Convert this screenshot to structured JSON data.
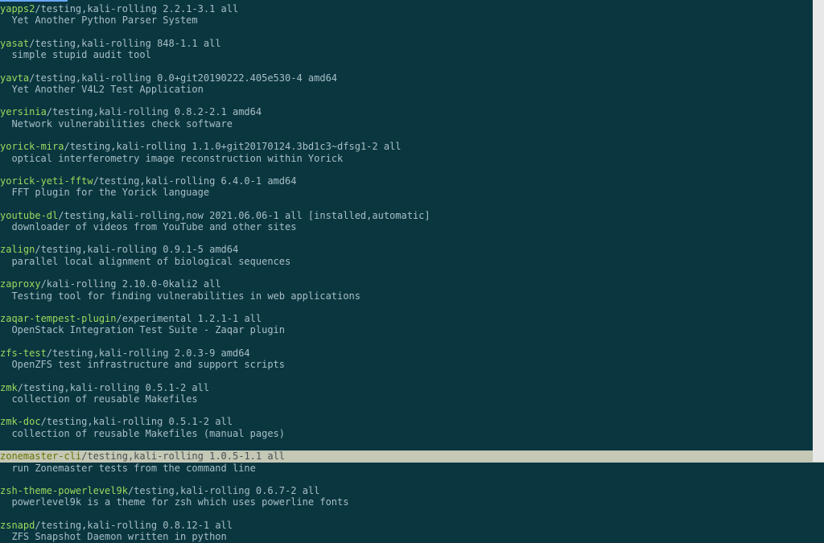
{
  "packages": [
    {
      "name": "yapps2",
      "meta": "/testing,kali-rolling 2.2.1-3.1 all",
      "desc": "Yet Another Python Parser System",
      "highlighted": false
    },
    {
      "name": "yasat",
      "meta": "/testing,kali-rolling 848-1.1 all",
      "desc": "simple stupid audit tool",
      "highlighted": false
    },
    {
      "name": "yavta",
      "meta": "/testing,kali-rolling 0.0+git20190222.405e530-4 amd64",
      "desc": "Yet Another V4L2 Test Application",
      "highlighted": false
    },
    {
      "name": "yersinia",
      "meta": "/testing,kali-rolling 0.8.2-2.1 amd64",
      "desc": "Network vulnerabilities check software",
      "highlighted": false
    },
    {
      "name": "yorick-mira",
      "meta": "/testing,kali-rolling 1.1.0+git20170124.3bd1c3~dfsg1-2 all",
      "desc": "optical interferometry image reconstruction within Yorick",
      "highlighted": false
    },
    {
      "name": "yorick-yeti-fftw",
      "meta": "/testing,kali-rolling 6.4.0-1 amd64",
      "desc": "FFT plugin for the Yorick language",
      "highlighted": false
    },
    {
      "name": "youtube-dl",
      "meta": "/testing,kali-rolling,now 2021.06.06-1 all [installed,automatic]",
      "desc": "downloader of videos from YouTube and other sites",
      "highlighted": false
    },
    {
      "name": "zalign",
      "meta": "/testing,kali-rolling 0.9.1-5 amd64",
      "desc": "parallel local alignment of biological sequences",
      "highlighted": false
    },
    {
      "name": "zaproxy",
      "meta": "/kali-rolling 2.10.0-0kali2 all",
      "desc": "Testing tool for finding vulnerabilities in web applications",
      "highlighted": false
    },
    {
      "name": "zaqar-tempest-plugin",
      "meta": "/experimental 1.2.1-1 all",
      "desc": "OpenStack Integration Test Suite - Zaqar plugin",
      "highlighted": false
    },
    {
      "name": "zfs-test",
      "meta": "/testing,kali-rolling 2.0.3-9 amd64",
      "desc": "OpenZFS test infrastructure and support scripts",
      "highlighted": false
    },
    {
      "name": "zmk",
      "meta": "/testing,kali-rolling 0.5.1-2 all",
      "desc": "collection of reusable Makefiles",
      "highlighted": false
    },
    {
      "name": "zmk-doc",
      "meta": "/testing,kali-rolling 0.5.1-2 all",
      "desc": "collection of reusable Makefiles (manual pages)",
      "highlighted": false
    },
    {
      "name": "zonemaster-cli",
      "meta": "/testing,kali-rolling 1.0.5-1.1 all",
      "desc": "run Zonemaster tests from the command line",
      "highlighted": true
    },
    {
      "name": "zsh-theme-powerlevel9k",
      "meta": "/testing,kali-rolling 0.6.7-2 all",
      "desc": "powerlevel9k is a theme for zsh which uses powerline fonts",
      "highlighted": false
    },
    {
      "name": "zsnapd",
      "meta": "/testing,kali-rolling 0.8.12-1 all",
      "desc": "ZFS Snapshot Daemon written in python",
      "highlighted": false
    }
  ]
}
